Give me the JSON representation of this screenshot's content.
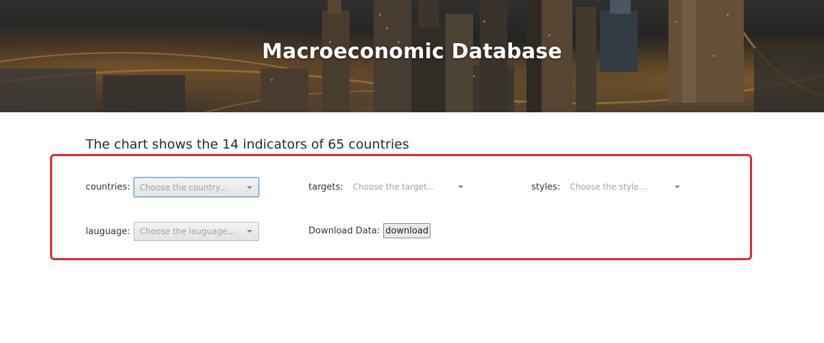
{
  "hero": {
    "title": "Macroeconomic Database"
  },
  "heading": "The chart shows the 14 indicators of 65 countries",
  "filters": {
    "countries": {
      "label": "countries:",
      "placeholder": "Choose the country..."
    },
    "targets": {
      "label": "targets:",
      "placeholder": "Choose the target..."
    },
    "styles": {
      "label": "styles:",
      "placeholder": "Choose the style..."
    },
    "language": {
      "label": "lauguage:",
      "placeholder": "Choose the lauguage..."
    },
    "download": {
      "label": "Download Data:",
      "button": "download"
    }
  },
  "colors": {
    "highlight_border": "#e8232a",
    "focus_border": "#5b9bd5"
  }
}
